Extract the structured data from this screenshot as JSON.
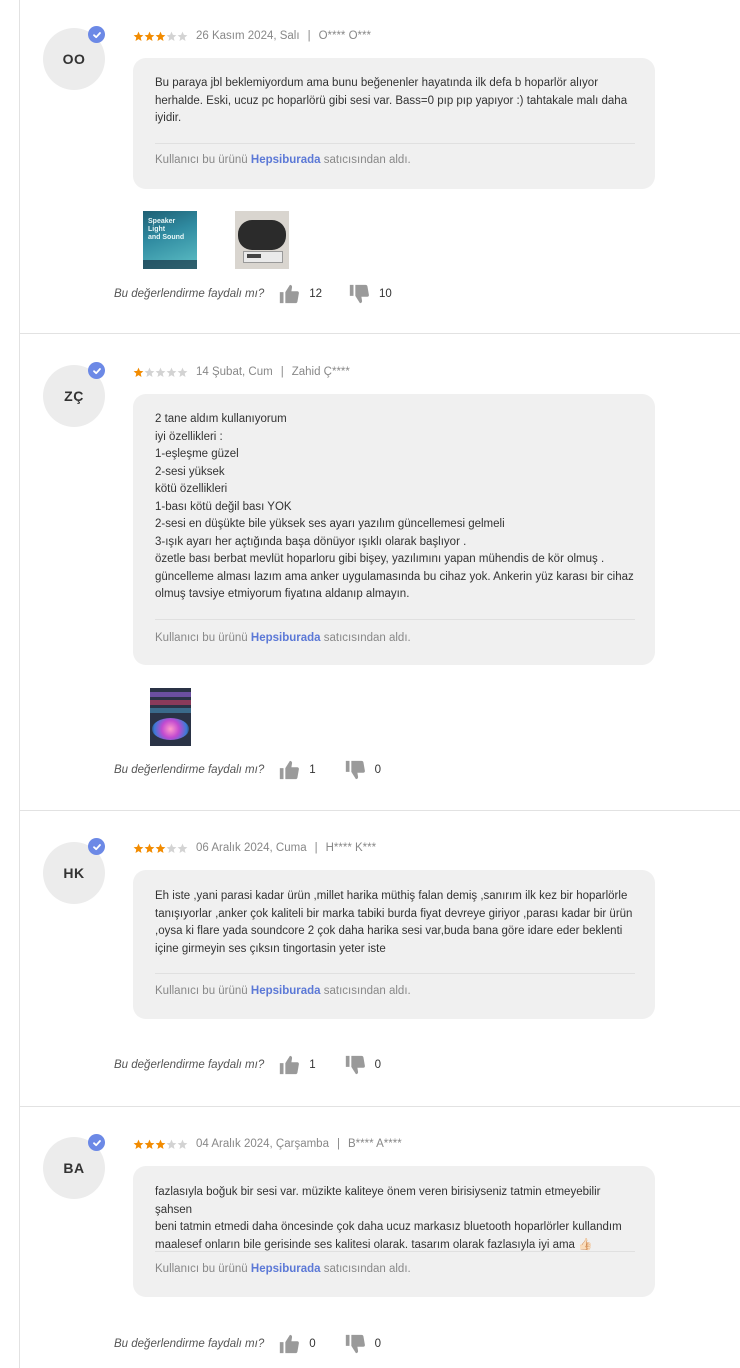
{
  "reviews": [
    {
      "initials": "OO",
      "rating": 3,
      "date": "26 Kasım 2024, Salı",
      "author": "O**** O***",
      "text": "Bu paraya jbl beklemiyordum ama bunu beğenenler hayatında ilk defa b hoparlör alıyor\nherhalde. Eski, ucuz pc hoparlörü gibi sesi var. Bass=0 pıp pıp yapıyor :) tahtakale malı daha\niyidir.",
      "seller_prefix": "Kullanıcı bu ürünü ",
      "seller_name": "Hepsiburada",
      "seller_suffix": " satıcısından aldı.",
      "helpful_question": "Bu değerlendirme faydalı mı?",
      "likes": "12",
      "dislikes": "10",
      "image_text": "Speaker\nLight\nand Sound"
    },
    {
      "initials": "ZÇ",
      "rating": 1,
      "date": "14 Şubat, Cum",
      "author": "Zahid Ç****",
      "text": "2 tane aldım kullanıyorum\niyi özellikleri :\n1-eşleşme güzel\n2-sesi yüksek\nkötü özellikleri\n1-bası kötü değil bası YOK\n2-sesi en düşükte bile yüksek ses ayarı yazılım güncellemesi gelmeli\n3-ışık ayarı her açtığında başa dönüyor ışıklı olarak başlıyor .\nözetle bası berbat mevlüt hoparloru gibi bişey, yazılımını yapan mühendis de kör olmuş .\ngüncelleme alması lazım ama  anker uygulamasında bu cihaz yok. Ankerin yüz karası bir cihaz\nolmuş tavsiye etmiyorum fiyatına aldanıp almayın.",
      "seller_prefix": "Kullanıcı bu ürünü ",
      "seller_name": "Hepsiburada",
      "seller_suffix": " satıcısından aldı.",
      "helpful_question": "Bu değerlendirme faydalı mı?",
      "likes": "1",
      "dislikes": "0"
    },
    {
      "initials": "HK",
      "rating": 3,
      "date": "06 Aralık 2024, Cuma",
      "author": "H**** K***",
      "text": "Eh iste ,yani parasi kadar ürün ,millet harika müthiş falan demiş ,sanırım  ilk kez bir hoparlörle\ntanışıyorlar ,anker çok kaliteli bir marka tabiki burda fiyat devreye giriyor ,parası kadar bir ürün\n,oysa ki flare yada soundcore 2 çok daha harika sesi var,buda bana göre idare eder  beklenti\niçine girmeyin ses çıksın tingortasin yeter iste",
      "seller_prefix": "Kullanıcı bu ürünü ",
      "seller_name": "Hepsiburada",
      "seller_suffix": " satıcısından aldı.",
      "helpful_question": "Bu değerlendirme faydalı mı?",
      "likes": "1",
      "dislikes": "0"
    },
    {
      "initials": "BA",
      "rating": 3,
      "date": "04 Aralık 2024, Çarşamba",
      "author": "B**** A****",
      "text": "fazlasıyla boğuk bir sesi var. müzikte kaliteye önem veren birisiyseniz tatmin etmeyebilir şahsen\nbeni tatmin etmedi daha öncesinde çok daha ucuz markasız bluetooth hoparlörler kullandım\nmaalesef onların bile gerisinde ses kalitesi olarak. tasarım olarak fazlasıyla iyi ama 👍🏻",
      "seller_prefix": "Kullanıcı bu ürünü ",
      "seller_name": "Hepsiburada",
      "seller_suffix": " satıcısından aldı.",
      "helpful_question": "Bu değerlendirme faydalı mı?",
      "likes": "0",
      "dislikes": "0"
    }
  ],
  "colors": {
    "star_filled": "#f28b00",
    "star_empty": "#d3d3d3",
    "verified": "#6c89e6",
    "store_link": "#5b78d6"
  },
  "icons": {
    "verified": "check-badge-icon",
    "like": "thumbs-up-icon",
    "dislike": "thumbs-down-icon",
    "star": "star-icon"
  }
}
